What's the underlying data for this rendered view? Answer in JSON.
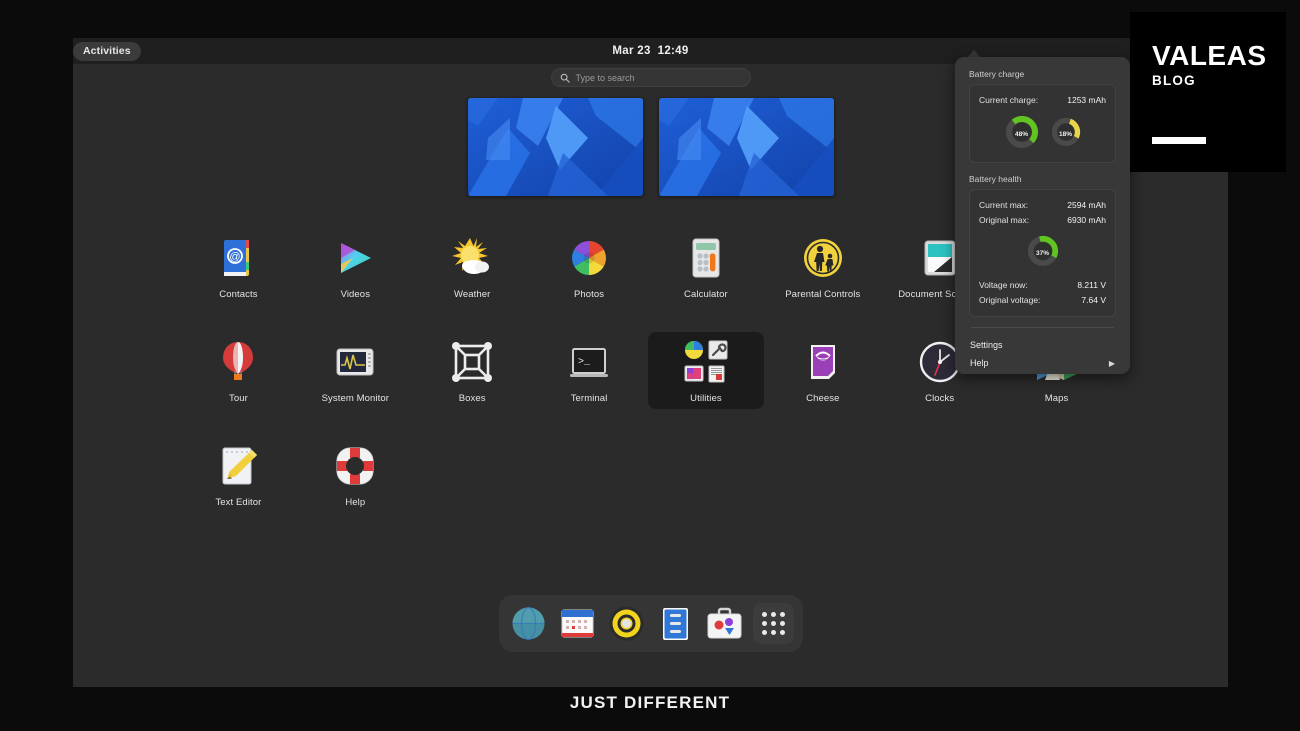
{
  "topbar": {
    "activities_label": "Activities",
    "date": "Mar 23",
    "time": "12:49"
  },
  "search": {
    "placeholder": "Type to search",
    "icon": "search-icon"
  },
  "workspaces": [
    {
      "name": "workspace-1",
      "wallpaper": "blue-geometric"
    },
    {
      "name": "workspace-2",
      "wallpaper": "blue-geometric"
    }
  ],
  "apps": [
    {
      "label": "Contacts",
      "icon": "contacts-icon",
      "highlight": false
    },
    {
      "label": "Videos",
      "icon": "videos-icon",
      "highlight": false
    },
    {
      "label": "Weather",
      "icon": "weather-icon",
      "highlight": false
    },
    {
      "label": "Photos",
      "icon": "photos-icon",
      "highlight": false
    },
    {
      "label": "Calculator",
      "icon": "calculator-icon",
      "highlight": false
    },
    {
      "label": "Parental Controls",
      "icon": "parental-controls-icon",
      "highlight": false
    },
    {
      "label": "Document Scanner",
      "icon": "document-scanner-icon",
      "highlight": false
    },
    {
      "label": "",
      "icon": "empty-slot",
      "highlight": false
    },
    {
      "label": "Tour",
      "icon": "tour-icon",
      "highlight": false
    },
    {
      "label": "System Monitor",
      "icon": "system-monitor-icon",
      "highlight": false
    },
    {
      "label": "Boxes",
      "icon": "boxes-icon",
      "highlight": false
    },
    {
      "label": "Terminal",
      "icon": "terminal-icon",
      "highlight": false
    },
    {
      "label": "Utilities",
      "icon": "utilities-folder-icon",
      "highlight": true
    },
    {
      "label": "Cheese",
      "icon": "cheese-icon",
      "highlight": false
    },
    {
      "label": "Clocks",
      "icon": "clocks-icon",
      "highlight": false
    },
    {
      "label": "Maps",
      "icon": "maps-icon",
      "highlight": false
    },
    {
      "label": "Text Editor",
      "icon": "text-editor-icon",
      "highlight": false
    },
    {
      "label": "Help",
      "icon": "help-icon",
      "highlight": false
    }
  ],
  "dock": [
    {
      "name": "web-browser-icon",
      "label": "Web"
    },
    {
      "name": "calendar-icon",
      "label": "Calendar"
    },
    {
      "name": "music-icon",
      "label": "Rhythmbox"
    },
    {
      "name": "files-icon",
      "label": "Files"
    },
    {
      "name": "software-icon",
      "label": "Software"
    },
    {
      "name": "show-apps-icon",
      "label": "Show Applications"
    }
  ],
  "battery_popup": {
    "charge_section_title": "Battery charge",
    "current_charge_label": "Current charge:",
    "current_charge_value": "1253 mAh",
    "gauge_charge_pct": "48%",
    "gauge_charge_color": "#62c420",
    "gauge_rate_pct": "18%",
    "gauge_rate_color": "#e8d54a",
    "health_section_title": "Battery health",
    "current_max_label": "Current max:",
    "current_max_value": "2594 mAh",
    "original_max_label": "Original max:",
    "original_max_value": "6930 mAh",
    "gauge_health_pct": "37%",
    "gauge_health_color": "#62c420",
    "voltage_now_label": "Voltage now:",
    "voltage_now_value": "8.211 V",
    "original_voltage_label": "Original voltage:",
    "original_voltage_value": "7.64 V",
    "settings_label": "Settings",
    "help_label": "Help",
    "help_arrow": "▶"
  },
  "watermark": {
    "main": "VALEAS",
    "sub": "BLOG"
  },
  "caption": "JUST DIFFERENT"
}
